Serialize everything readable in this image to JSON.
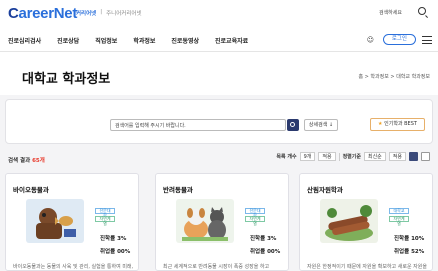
{
  "header": {
    "logo_prefix": "C",
    "logo_text": "areerNet",
    "sub_links": [
      "커리어넷",
      "주니어커리어넷"
    ],
    "top_search_label": "검색하세요",
    "login_label": "로그인"
  },
  "nav": {
    "items": [
      "진로심리검사",
      "진로상담",
      "직업정보",
      "학과정보",
      "진로동영상",
      "진로교육자료"
    ]
  },
  "page": {
    "title": "대학교 학과정보",
    "breadcrumb": "홈 > 학과정보 > 대학교 학과정보"
  },
  "search": {
    "placeholder": "검색어를 입력해 주시기 바랍니다.",
    "advanced_label": "상세검색 ↓",
    "popular_label": "인기학과 BEST"
  },
  "results": {
    "count_label": "검색 결과",
    "count_value": "65개",
    "list_count_label": "목록 개수",
    "list_count_value": "9개",
    "apply_label": "적용",
    "sort_label": "정렬기준",
    "sort_value": "최신순",
    "sort_apply_label": "적용"
  },
  "cards": [
    {
      "name": "바이오동물과",
      "badges": [
        "전문대학",
        "자연계열"
      ],
      "rate_1": "진학률 3%",
      "rate_2": "취업률 00%",
      "desc": "바이오동물과는 동물의 사육 및 관리, 실험을 통하여 미래,"
    },
    {
      "name": "반려동물과",
      "badges": [
        "전문대학",
        "자연계열"
      ],
      "rate_1": "진학률 3%",
      "rate_2": "취업률 00%",
      "desc": "최근 세계적으로 반려동물 시장이 폭증 성장을 하고"
    },
    {
      "name": "산림자원학과",
      "badges": [
        "대학교",
        "자연계열"
      ],
      "rate_1": "진학률 10%",
      "rate_2": "취업률 52%",
      "desc": "자원은 한정적이기 때문에 자원을 확보하고 새로운 자원을"
    }
  ],
  "colors": {
    "brand": "#2a6fdb",
    "accent_red": "#e8392b",
    "search_button": "#2b3a6e"
  }
}
